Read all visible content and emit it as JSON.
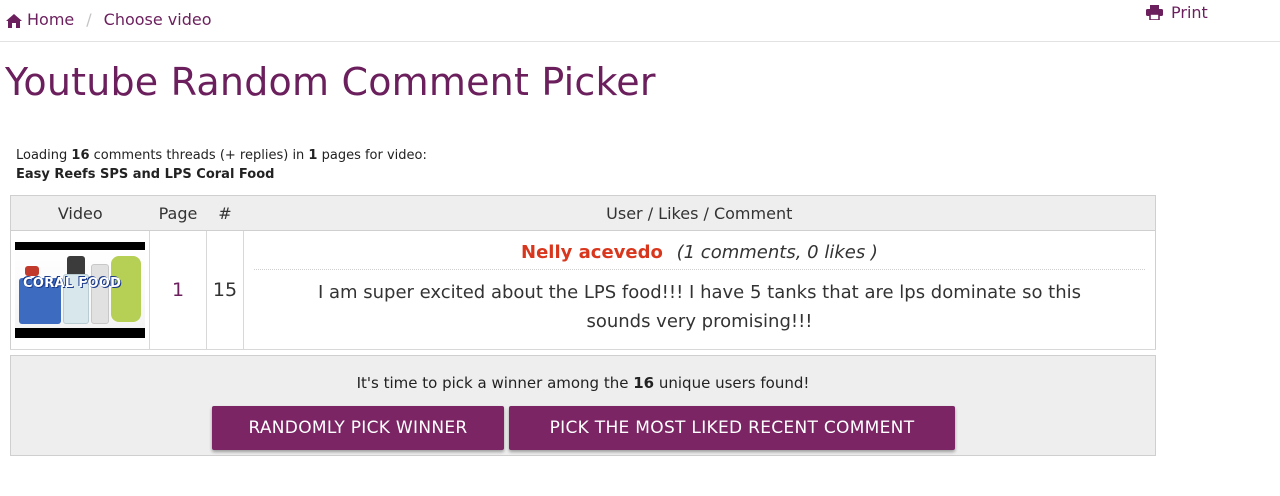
{
  "breadcrumb": {
    "home_label": "Home",
    "separator": "/",
    "current_label": "Choose video"
  },
  "print_label": "Print",
  "page_title": "Youtube Random Comment Picker",
  "loading": {
    "prefix": "Loading ",
    "comment_count": "16",
    "middle": " comments threads (+ replies) in ",
    "page_count": "1",
    "suffix": " pages for video:",
    "video_title": "Easy Reefs SPS and LPS Coral Food"
  },
  "table": {
    "headers": [
      "Video",
      "Page",
      "#",
      "User / Likes / Comment"
    ],
    "row": {
      "thumbnail_text": "CORAL FOOD",
      "page": "1",
      "number": "15",
      "user": "Nelly acevedo",
      "user_meta": "(1 comments, 0 likes )",
      "comment": "I am super excited about the LPS food!!! I have 5 tanks that are lps dominate so this sounds very promising!!!"
    }
  },
  "pick": {
    "text_prefix": "It's time to pick a winner among the ",
    "unique_users": "16",
    "text_suffix": " unique users found!",
    "random_button": "RANDOMLY PICK WINNER",
    "liked_button": "PICK THE MOST LIKED RECENT COMMENT"
  },
  "colors": {
    "brand": "#6b1f5c",
    "button": "#7b2565",
    "user_name": "#d9371d"
  },
  "icons": {
    "home": "home-icon",
    "print": "print-icon"
  }
}
